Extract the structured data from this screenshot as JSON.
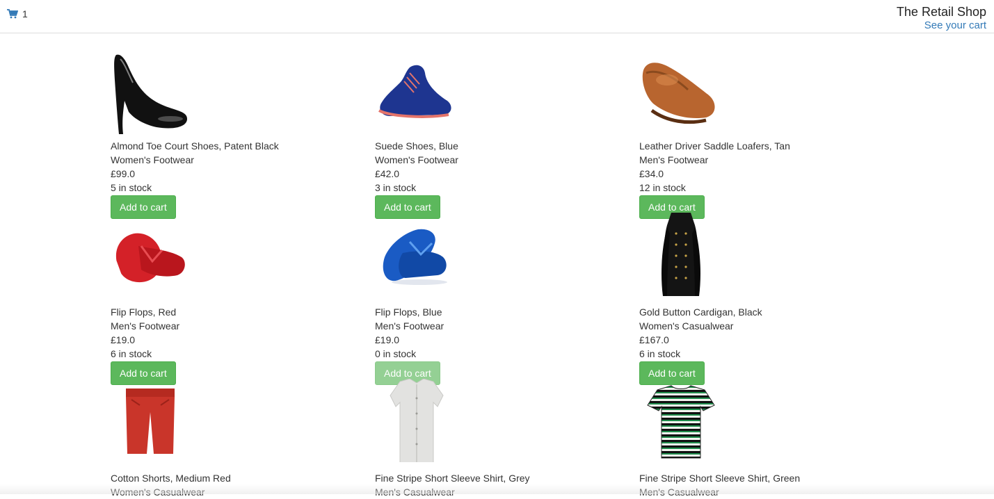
{
  "header": {
    "cart_count": "1",
    "shop_title": "The Retail Shop",
    "see_cart_label": "See your cart",
    "cart_icon": "shopping-cart-icon"
  },
  "colors": {
    "accent_link": "#337ab7",
    "button_green": "#5cb85c"
  },
  "products": [
    {
      "name": "Almond Toe Court Shoes, Patent Black",
      "category": "Women's Footwear",
      "price": "£99.0",
      "stock": "5 in stock",
      "button": "Add to cart",
      "image": "black-court-shoe"
    },
    {
      "name": "Suede Shoes, Blue",
      "category": "Women's Footwear",
      "price": "£42.0",
      "stock": "3 in stock",
      "button": "Add to cart",
      "image": "blue-suede-shoe"
    },
    {
      "name": "Leather Driver Saddle Loafers, Tan",
      "category": "Men's Footwear",
      "price": "£34.0",
      "stock": "12 in stock",
      "button": "Add to cart",
      "image": "tan-loafer"
    },
    {
      "name": "Flip Flops, Red",
      "category": "Men's Footwear",
      "price": "£19.0",
      "stock": "6 in stock",
      "button": "Add to cart",
      "image": "red-flip-flops"
    },
    {
      "name": "Flip Flops, Blue",
      "category": "Men's Footwear",
      "price": "£19.0",
      "stock": "0 in stock",
      "button": "Add to cart",
      "image": "blue-flip-flops",
      "disabled": true
    },
    {
      "name": "Gold Button Cardigan, Black",
      "category": "Women's Casualwear",
      "price": "£167.0",
      "stock": "6 in stock",
      "button": "Add to cart",
      "image": "black-cardigan"
    },
    {
      "name": "Cotton Shorts, Medium Red",
      "category": "Women's Casualwear",
      "image": "red-shorts"
    },
    {
      "name": "Fine Stripe Short Sleeve Shirt, Grey",
      "category": "Men's Casualwear",
      "image": "grey-shirt"
    },
    {
      "name": "Fine Stripe Short Sleeve Shirt, Green",
      "category": "Men's Casualwear",
      "image": "green-striped-tshirt"
    }
  ]
}
